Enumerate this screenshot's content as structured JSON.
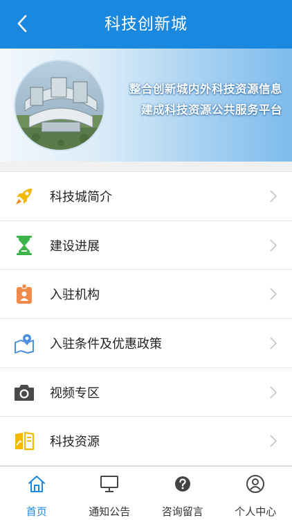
{
  "header": {
    "title": "科技创新城",
    "back_icon": "chevron-left-icon"
  },
  "banner": {
    "line1": "整合创新城内外科技资源信息",
    "line2": "建成科技资源公共服务平台"
  },
  "menu": {
    "items": [
      {
        "label": "科技城简介",
        "icon": "rocket-icon",
        "color": "#f5b800"
      },
      {
        "label": "建设进展",
        "icon": "hourglass-icon",
        "color": "#3db44a"
      },
      {
        "label": "入驻机构",
        "icon": "badge-icon",
        "color": "#f08a4b"
      },
      {
        "label": "入驻条件及优惠政策",
        "icon": "map-pin-icon",
        "color": "#4a8fe0"
      },
      {
        "label": "视频专区",
        "icon": "camera-icon",
        "color": "#4a4a4a"
      },
      {
        "label": "科技资源",
        "icon": "open-book-icon",
        "color": "#f5b800"
      }
    ]
  },
  "tabbar": {
    "tabs": [
      {
        "label": "首页",
        "icon": "home-icon",
        "active": true
      },
      {
        "label": "通知公告",
        "icon": "monitor-icon",
        "active": false
      },
      {
        "label": "咨询留言",
        "icon": "question-icon",
        "active": false
      },
      {
        "label": "个人中心",
        "icon": "user-icon",
        "active": false
      }
    ]
  },
  "colors": {
    "primary": "#1a88de",
    "tab_inactive": "#444444"
  }
}
